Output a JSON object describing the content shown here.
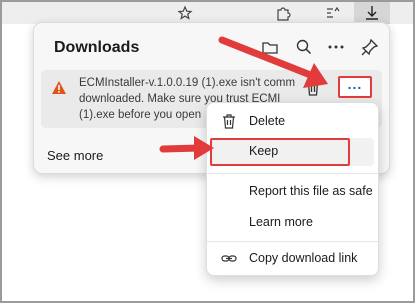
{
  "downloads": {
    "title": "Downloads",
    "item_text_line1": "ECMInstaller-v.1.0.0.19 (1).exe isn't comm",
    "item_text_line2": "downloaded. Make sure you trust ECMI",
    "item_text_line3": "(1).exe before you open",
    "see_more": "See more",
    "more_dots": "..."
  },
  "menu": {
    "items": [
      {
        "label": "Delete",
        "icon": "trash-icon"
      },
      {
        "label": "Keep",
        "icon": ""
      },
      {
        "label": "Report this file as safe",
        "icon": ""
      },
      {
        "label": "Learn more",
        "icon": ""
      },
      {
        "label": "Copy download link",
        "icon": "link-icon"
      }
    ]
  },
  "colors": {
    "annotation_red": "#e23b3b",
    "warning_orange": "#e0531b",
    "accent_blue": "#1a5fb4"
  }
}
